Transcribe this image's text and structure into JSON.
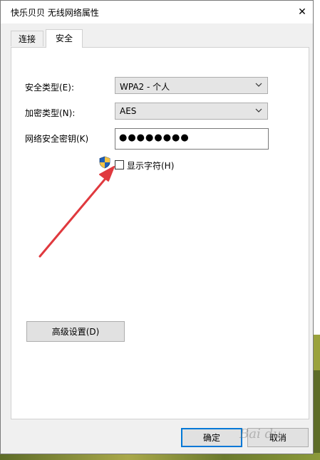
{
  "window": {
    "title": "快乐贝贝 无线网络属性",
    "close_glyph": "✕"
  },
  "tabs": [
    {
      "label": "连接",
      "active": false
    },
    {
      "label": "安全",
      "active": true
    }
  ],
  "security": {
    "type_label": "安全类型(E):",
    "type_value": "WPA2 - 个人",
    "encryption_label": "加密类型(N):",
    "encryption_value": "AES",
    "key_label": "网络安全密钥(K)",
    "key_masked": "●●●●●●●●",
    "show_chars_label": "显示字符(H)",
    "show_chars_checked": false
  },
  "buttons": {
    "advanced": "高级设置(D)",
    "ok": "确定",
    "cancel": "取消"
  },
  "watermark": "Bai du"
}
